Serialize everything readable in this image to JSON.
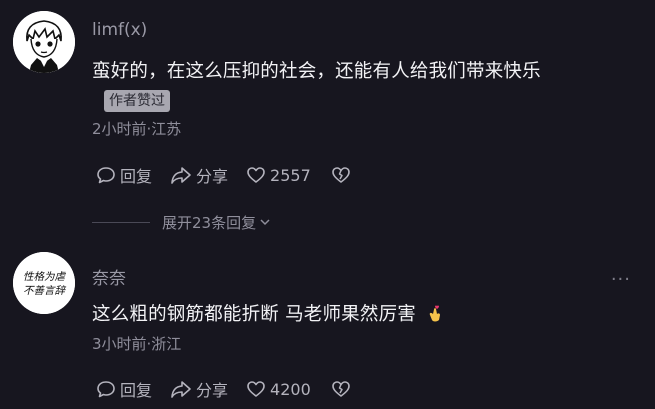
{
  "comments": [
    {
      "username": "limf(x)",
      "text": "蛮好的，在这么压抑的社会，还能有人给我们带来快乐",
      "badge": "作者赞过",
      "meta": "2小时前·江苏",
      "reply_label": "回复",
      "share_label": "分享",
      "like_count": "2557",
      "avatar_icon": "anime-boy-avatar-icon"
    },
    {
      "username": "奈奈",
      "text": "这么粗的钢筋都能折断 马老师果然厉害",
      "meta": "3小时前·浙江",
      "reply_label": "回复",
      "share_label": "分享",
      "like_count": "4200",
      "avatar_icon": "calligraphy-avatar-icon",
      "avatar_text_line1": "性格为虐",
      "avatar_text_line2": "不善言辞"
    }
  ],
  "expand_replies": "展开23条回复",
  "more_label": "···",
  "colors": {
    "background": "#17161f",
    "username": "#9a99a6",
    "meta": "#8f8e9b",
    "badge_bg": "#a8a7b0"
  }
}
